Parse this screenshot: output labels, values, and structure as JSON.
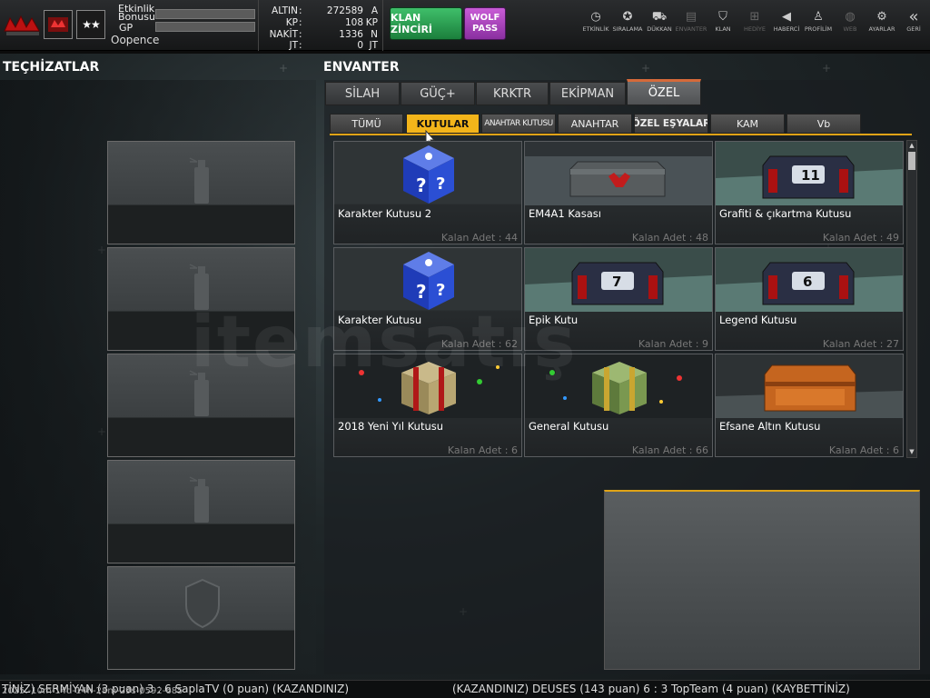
{
  "header": {
    "etkinlik_label": "Etkinlik",
    "bonusu_label": "Bonusu",
    "gp_label": "GP",
    "username": "Oopence",
    "rank_symbol": "★★",
    "currencies": [
      {
        "name": "ALTIN",
        "value": "272589",
        "unit": "A"
      },
      {
        "name": "KP",
        "value": "108",
        "unit": "KP"
      },
      {
        "name": "NAKİT",
        "value": "1336",
        "unit": "N"
      },
      {
        "name": "JT",
        "value": "0",
        "unit": "JT"
      }
    ],
    "klan_button": "KLAN ZİNCİRİ",
    "wolf_pass_line1": "WOLF",
    "wolf_pass_line2": "PASS"
  },
  "menu": [
    {
      "label": "ETKİNLİK",
      "icon": "stopwatch-icon",
      "glyph": "◷",
      "dim": false
    },
    {
      "label": "SIRALAMA",
      "icon": "medal-icon",
      "glyph": "✪",
      "dim": false
    },
    {
      "label": "DÜKKAN",
      "icon": "cart-icon",
      "glyph": "⛟",
      "dim": false
    },
    {
      "label": "ENVANTER",
      "icon": "inventory-icon",
      "glyph": "▤",
      "dim": true
    },
    {
      "label": "KLAN",
      "icon": "clan-shield-icon",
      "glyph": "⛉",
      "dim": false
    },
    {
      "label": "HEDİYE",
      "icon": "gift-icon",
      "glyph": "⊞",
      "dim": true
    },
    {
      "label": "HABERCİ",
      "icon": "megaphone-icon",
      "glyph": "◀",
      "dim": false
    },
    {
      "label": "PROFİLİM",
      "icon": "profile-icon",
      "glyph": "♙",
      "dim": false
    },
    {
      "label": "WEB",
      "icon": "globe-icon",
      "glyph": "◍",
      "dim": true
    },
    {
      "label": "AYARLAR",
      "icon": "gear-icon",
      "glyph": "⚙",
      "dim": false
    },
    {
      "label": "GERİ",
      "icon": "back-icon",
      "glyph": "«",
      "dim": false
    }
  ],
  "left": {
    "title": "TEÇHİZATLAR"
  },
  "inventory": {
    "title": "ENVANTER",
    "tabs": [
      "SİLAH",
      "GÜÇ+",
      "KRKTR",
      "EKİPMAN",
      "ÖZEL"
    ],
    "active_tab": "ÖZEL",
    "subtabs": [
      "TÜMÜ",
      "KUTULAR",
      "ANAHTAR KUTUSU",
      "ANAHTAR",
      "ÖZEL EŞYALAR",
      "KAM",
      "Vb"
    ],
    "active_subtab": "KUTULAR",
    "items": [
      {
        "name": "Karakter Kutusu 2",
        "count": "Kalan Adet : 44",
        "image": "blue-question-box"
      },
      {
        "name": "EM4A1 Kasası",
        "count": "Kalan Adet : 48",
        "image": "grey-weapon-case"
      },
      {
        "name": "Grafiti & çıkartma Kutusu",
        "count": "Kalan Adet : 49",
        "image": "metal-case-11"
      },
      {
        "name": "Karakter Kutusu",
        "count": "Kalan Adet : 62",
        "image": "blue-question-box"
      },
      {
        "name": "Epik Kutu",
        "count": "Kalan Adet : 9",
        "image": "metal-case-7"
      },
      {
        "name": "Legend Kutusu",
        "count": "Kalan Adet : 27",
        "image": "metal-case-6"
      },
      {
        "name": "2018 Yeni Yıl Kutusu",
        "count": "Kalan Adet : 6",
        "image": "gift-box"
      },
      {
        "name": "General Kutusu",
        "count": "Kalan Adet : 66",
        "image": "green-gift-box"
      },
      {
        "name": "Efsane Altın Kutusu",
        "count": "Kalan Adet : 6",
        "image": "copper-case"
      }
    ]
  },
  "ticker": {
    "left": "TİNİZ) SERMİYAN (3 puan) 3 : 6 SaplaTV (0 puan) (KAZANDINIZ)",
    "right": "(KAZANDINIZ) DEUSES (143 puan) 6 : 3 TopTeam (4 puan) (KAYBETTİNİZ)",
    "timestamp": "2025.-10m-14d-14h-28m-29s-0592-685"
  },
  "watermark": "itemsatış",
  "colors": {
    "accent": "#f3b51a",
    "tab_highlight": "#d66a3a",
    "klan_green": "#2a9d52",
    "wolf_purple": "#a844bb"
  }
}
